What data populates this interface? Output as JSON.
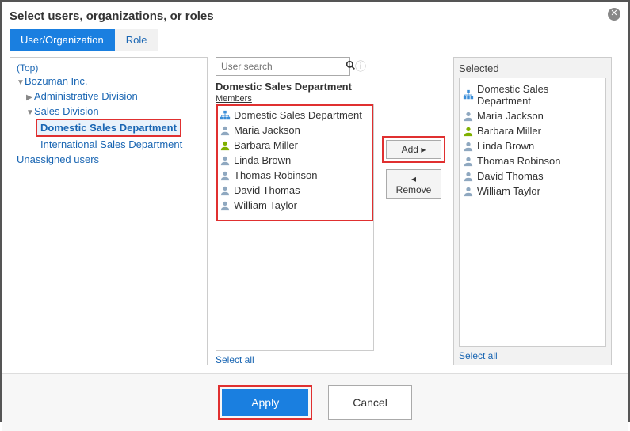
{
  "dialog": {
    "title": "Select users, organizations, or roles"
  },
  "tabs": {
    "user_org": "User/Organization",
    "role": "Role"
  },
  "tree": {
    "top": "(Top)",
    "org_root": "Bozuman Inc.",
    "admin_div": "Administrative Division",
    "sales_div": "Sales Division",
    "domestic_sales": "Domestic Sales Department",
    "international_sales": "International Sales Department",
    "unassigned": "Unassigned users"
  },
  "search": {
    "placeholder": "User search"
  },
  "members": {
    "title": "Domestic Sales Department",
    "label": "Members",
    "items": [
      {
        "type": "org",
        "name": "Domestic Sales Department"
      },
      {
        "type": "user",
        "name": "Maria Jackson"
      },
      {
        "type": "user-login",
        "name": "Barbara Miller"
      },
      {
        "type": "user",
        "name": "Linda Brown"
      },
      {
        "type": "user",
        "name": "Thomas Robinson"
      },
      {
        "type": "user",
        "name": "David Thomas"
      },
      {
        "type": "user",
        "name": "William Taylor"
      }
    ],
    "select_all": "Select all"
  },
  "buttons": {
    "add": "Add",
    "remove": "Remove"
  },
  "selected": {
    "title": "Selected",
    "items": [
      {
        "type": "org",
        "name": "Domestic Sales Department"
      },
      {
        "type": "user",
        "name": "Maria Jackson"
      },
      {
        "type": "user-login",
        "name": "Barbara Miller"
      },
      {
        "type": "user",
        "name": "Linda Brown"
      },
      {
        "type": "user",
        "name": "Thomas Robinson"
      },
      {
        "type": "user",
        "name": "David Thomas"
      },
      {
        "type": "user",
        "name": "William Taylor"
      }
    ],
    "select_all": "Select all"
  },
  "footer": {
    "apply": "Apply",
    "cancel": "Cancel"
  }
}
